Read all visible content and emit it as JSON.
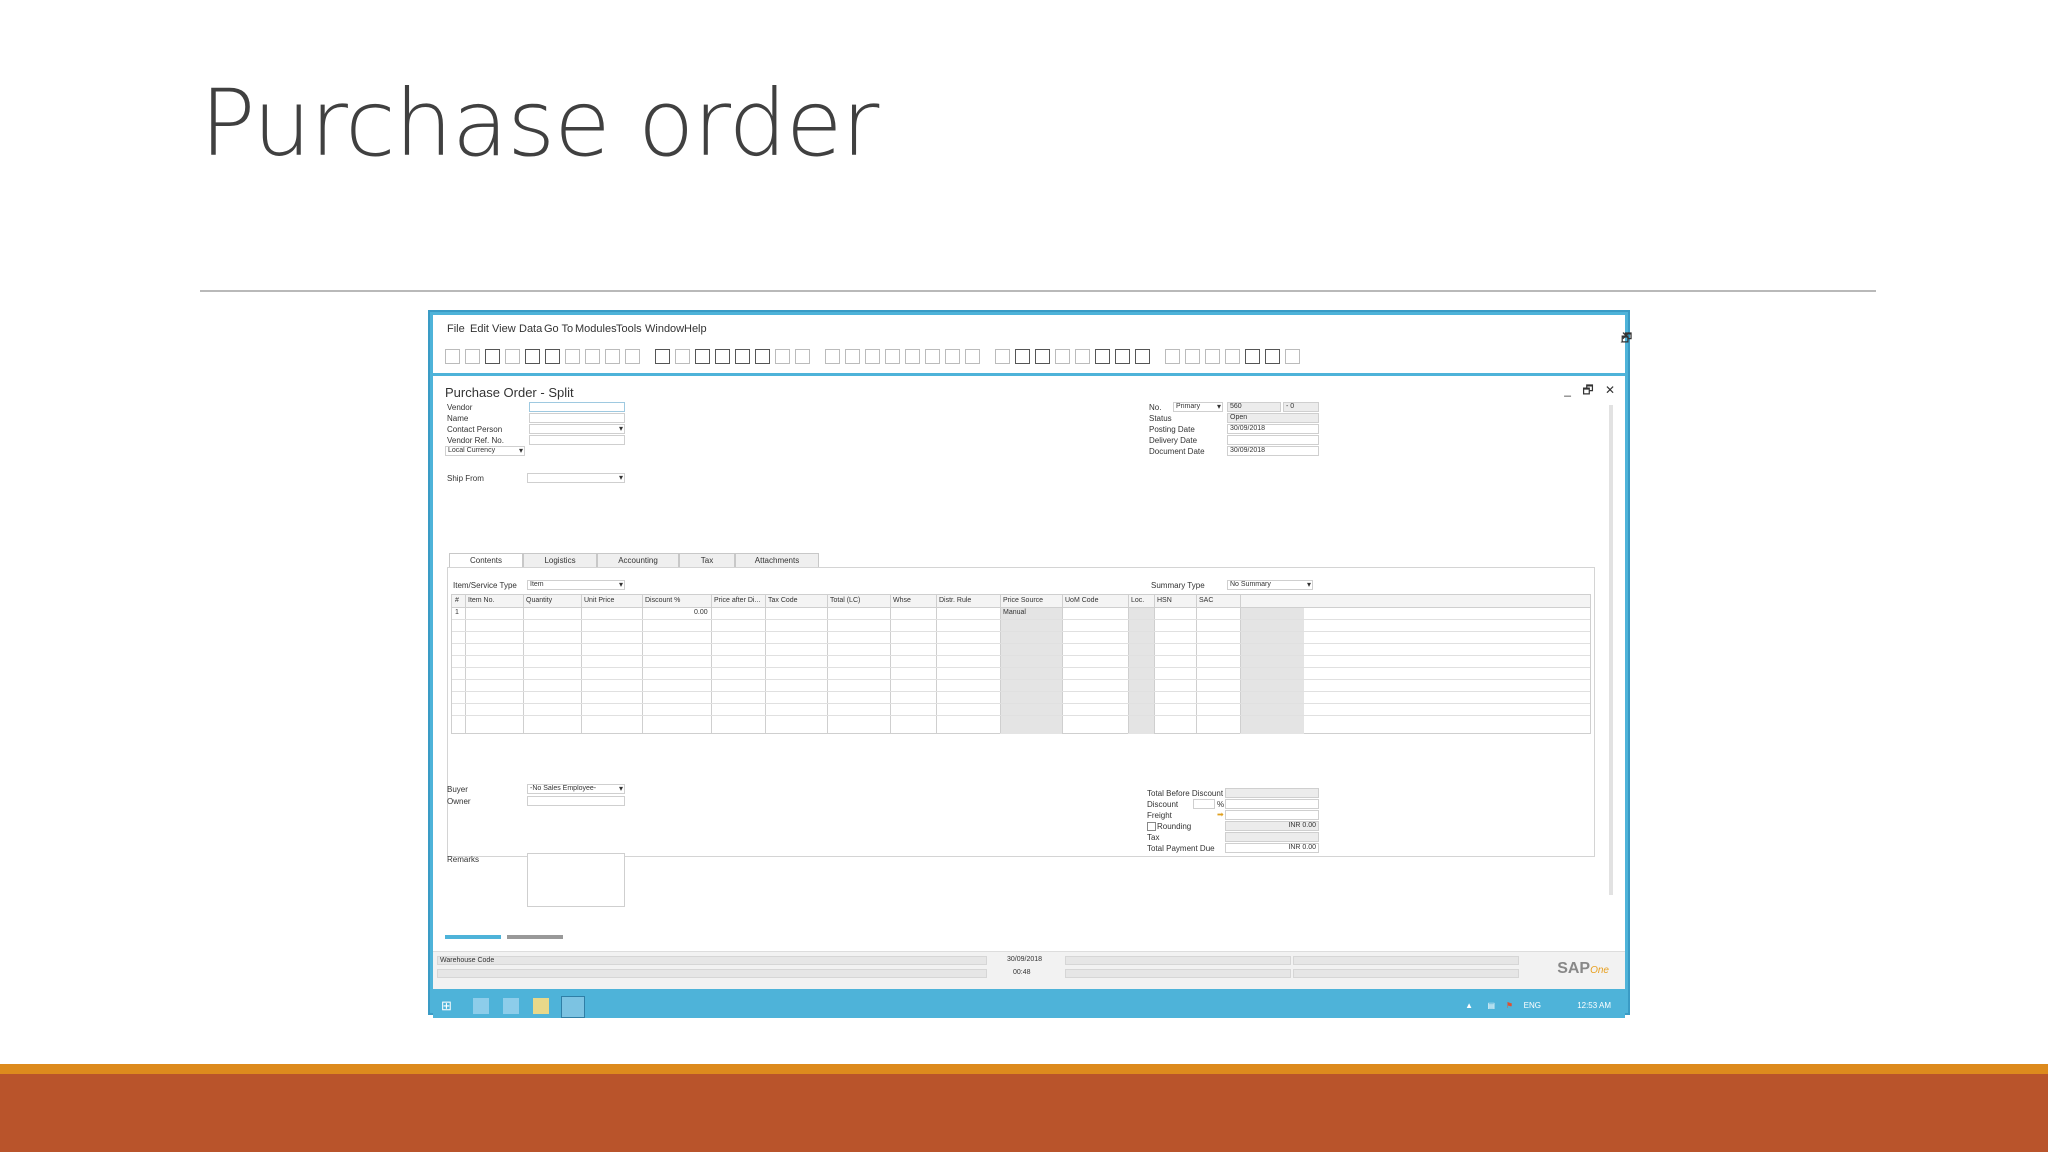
{
  "slide": {
    "title": "Purchase order"
  },
  "menu": [
    "File",
    "Edit",
    "View",
    "Data",
    "Go To",
    "Modules",
    "Tools",
    "Window",
    "Help"
  ],
  "window_controls": [
    "_",
    "🗗",
    "✕"
  ],
  "document": {
    "title": "Purchase Order - Split"
  },
  "header_left": {
    "vendor_label": "Vendor",
    "name_label": "Name",
    "contact_label": "Contact Person",
    "vendor_ref_label": "Vendor Ref. No.",
    "currency_value": "Local Currency",
    "ship_from_label": "Ship From"
  },
  "header_right": {
    "no_label": "No.",
    "series_value": "Primary",
    "no_value": "560",
    "no_suffix": "- 0",
    "status_label": "Status",
    "status_value": "Open",
    "posting_label": "Posting Date",
    "posting_value": "30/09/2018",
    "delivery_label": "Delivery Date",
    "document_label": "Document Date",
    "document_value": "30/09/2018"
  },
  "tabs": [
    "Contents",
    "Logistics",
    "Accounting",
    "Tax",
    "Attachments"
  ],
  "contents": {
    "item_type_label": "Item/Service Type",
    "item_type_value": "Item",
    "summary_label": "Summary Type",
    "summary_value": "No Summary",
    "columns": [
      "#",
      "Item No.",
      "Quantity",
      "Unit Price",
      "Discount %",
      "Price after Di...",
      "Tax Code",
      "Total (LC)",
      "Whse",
      "Distr. Rule",
      "Price Source",
      "UoM Code",
      "Loc.",
      "HSN",
      "SAC"
    ],
    "row1": {
      "num": "1",
      "discount": "0.00",
      "price_source": "Manual"
    }
  },
  "footer_left": {
    "buyer_label": "Buyer",
    "buyer_value": "-No Sales Employee-",
    "owner_label": "Owner",
    "remarks_label": "Remarks"
  },
  "footer_right": {
    "total_before_label": "Total Before Discount",
    "discount_label": "Discount",
    "discount_pct": "%",
    "freight_label": "Freight",
    "rounding_label": "Rounding",
    "rounding_value": "INR 0.00",
    "tax_label": "Tax",
    "total_due_label": "Total Payment Due",
    "total_due_value": "INR 0.00"
  },
  "statusbar": {
    "warehouse_label": "Warehouse Code",
    "date": "30/09/2018",
    "time": "00:48"
  },
  "taskbar": {
    "lang": "ENG",
    "clock": "12:53 AM"
  },
  "brand": {
    "sap": "SAP",
    "sub": "One"
  },
  "colors": {
    "accent": "#4eb3d9",
    "orange": "#dd8a1d",
    "rust": "#b9542b"
  }
}
